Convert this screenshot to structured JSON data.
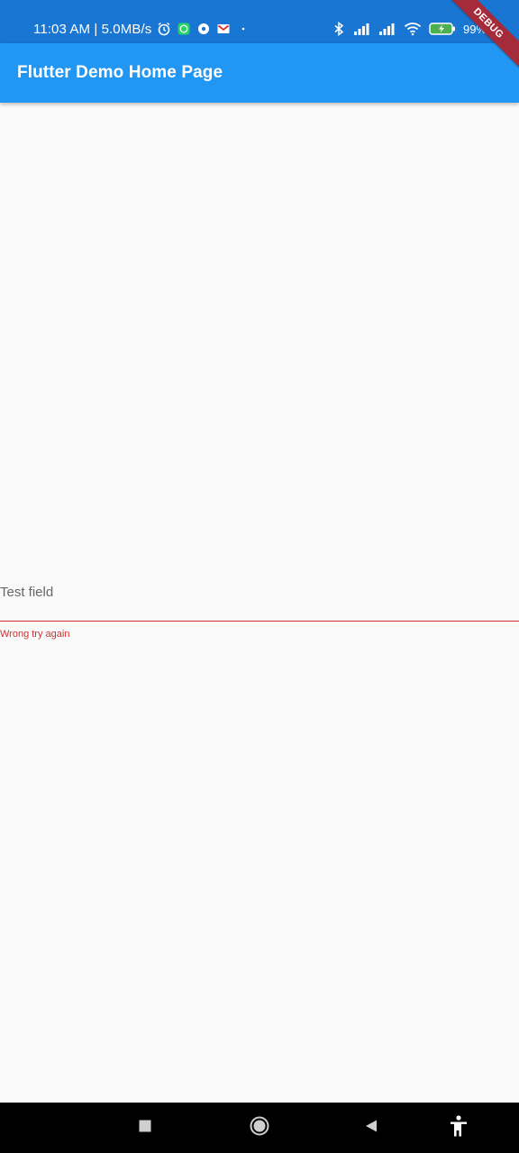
{
  "status_bar": {
    "time": "11:03 AM | 5.0MB/s",
    "battery_percent": "99%",
    "icons_left": [
      "alarm-icon",
      "whatsapp-icon",
      "settings-icon",
      "gmail-icon",
      "dot-icon"
    ],
    "icons_right": [
      "bluetooth-icon",
      "signal-icon",
      "signal-icon",
      "wifi-icon",
      "battery-charging-icon"
    ]
  },
  "app_bar": {
    "title": "Flutter Demo Home Page",
    "color": "#2196f3"
  },
  "debug_banner": {
    "label": "DEBUG"
  },
  "text_field": {
    "label": "Test field",
    "error_text": "Wrong try again",
    "error_color": "#d32f2f"
  },
  "nav_bar": {
    "buttons": [
      "recents-button",
      "home-button",
      "back-button",
      "accessibility-button"
    ]
  }
}
